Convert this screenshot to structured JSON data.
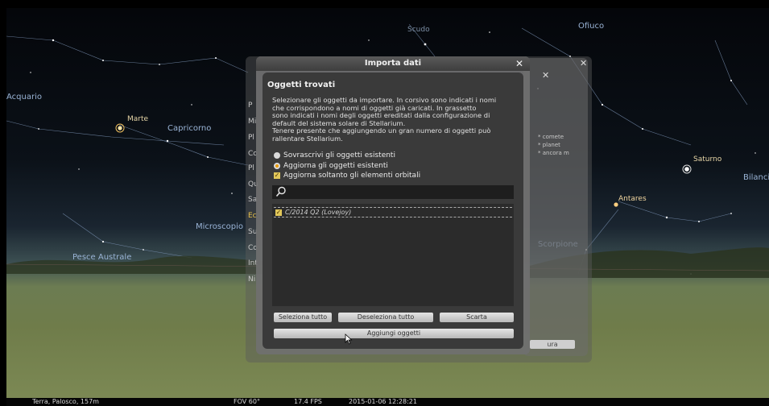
{
  "dialog": {
    "title": "Importa dati",
    "section_title": "Oggetti trovati",
    "description": [
      "Selezionare gli oggetti da importare. In corsivo sono indicati i nomi",
      "che corrispondono a nomi di oggetti già caricati. In grassetto",
      "sono indicati i nomi degli oggetti ereditati dalla configurazione di",
      "default del sistema solare di Stellarium.",
      "Tenere presente che aggiungendo un gran numero di oggetti può",
      "rallentare Stellarium."
    ],
    "options": {
      "overwrite": "Sovrascrivi gli oggetti esistenti",
      "update": "Aggiorna gli oggetti esistenti",
      "orbital_only": "Aggiorna soltanto gli elementi orbitali"
    },
    "list_items": [
      "C/2014 Q2 (Lovejoy)"
    ],
    "buttons": {
      "select_all": "Seleziona tutto",
      "deselect_all": "Deseleziona tutto",
      "discard": "Scarta",
      "add_objects": "Aggiungi oggetti"
    }
  },
  "background_dialogs": {
    "left_menu_letters": [
      "P",
      "Mi",
      "Pl",
      "Co",
      "Pl",
      "Qu",
      "Sa",
      "Ec",
      "Su",
      "Co",
      "Int",
      "Ni"
    ],
    "right_fragments": [
      "* comete",
      "* planet",
      "* ancora m",
      "ura"
    ]
  },
  "sky": {
    "constellations": [
      "Acquario",
      "Capricorno",
      "Microscopio",
      "Pesce Australe",
      "Scudo",
      "Ofiuco",
      "Scorpione",
      "Bilancia"
    ],
    "planets": [
      "Marte",
      "Saturno"
    ],
    "stars": [
      "Antares"
    ]
  },
  "statusbar": {
    "location": "Terra, Palosco, 157m",
    "fov": "FOV 60°",
    "fps": "17.4 FPS",
    "datetime": "2015-01-06 12:28:21"
  }
}
